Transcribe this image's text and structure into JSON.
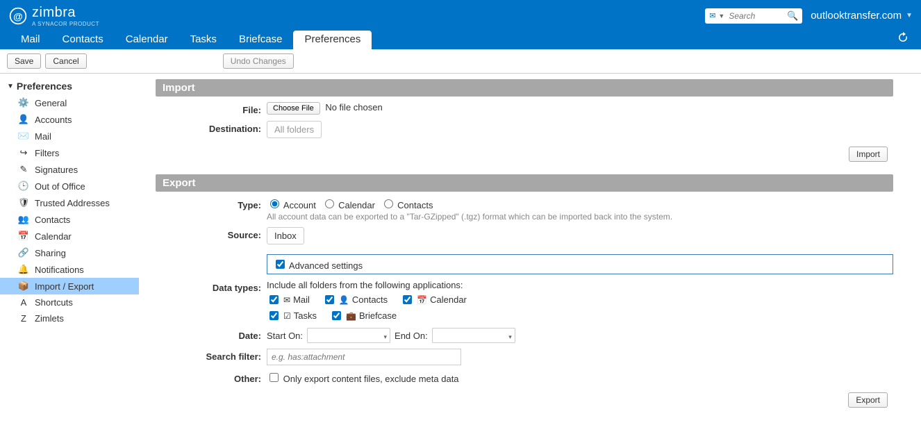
{
  "header": {
    "brand": "zimbra",
    "brand_sub": "A SYNACOR PRODUCT",
    "search_placeholder": "Search",
    "account": "outlooktransfer.com"
  },
  "nav": {
    "items": [
      "Mail",
      "Contacts",
      "Calendar",
      "Tasks",
      "Briefcase",
      "Preferences"
    ],
    "active": "Preferences"
  },
  "toolbar": {
    "save": "Save",
    "cancel": "Cancel",
    "undo": "Undo Changes"
  },
  "sidebar": {
    "title": "Preferences",
    "items": [
      {
        "label": "General",
        "icon": "⚙️"
      },
      {
        "label": "Accounts",
        "icon": "👤"
      },
      {
        "label": "Mail",
        "icon": "✉️"
      },
      {
        "label": "Filters",
        "icon": "↪"
      },
      {
        "label": "Signatures",
        "icon": "✎"
      },
      {
        "label": "Out of Office",
        "icon": "🕒"
      },
      {
        "label": "Trusted Addresses",
        "icon": "🛡"
      },
      {
        "label": "Contacts",
        "icon": "👥"
      },
      {
        "label": "Calendar",
        "icon": "📅"
      },
      {
        "label": "Sharing",
        "icon": "🔗"
      },
      {
        "label": "Notifications",
        "icon": "🔔"
      },
      {
        "label": "Import / Export",
        "icon": "📦",
        "selected": true
      },
      {
        "label": "Shortcuts",
        "icon": "A"
      },
      {
        "label": "Zimlets",
        "icon": "Z"
      }
    ]
  },
  "import": {
    "section": "Import",
    "file_label": "File:",
    "choose_file": "Choose File",
    "no_file": "No file chosen",
    "dest_label": "Destination:",
    "dest_value": "All folders",
    "button": "Import"
  },
  "export": {
    "section": "Export",
    "type_label": "Type:",
    "type_options": [
      "Account",
      "Calendar",
      "Contacts"
    ],
    "type_selected": "Account",
    "type_hint": "All account data can be exported to a \"Tar-GZipped\" (.tgz) format which can be imported back into the system.",
    "source_label": "Source:",
    "source_value": "Inbox",
    "advanced_label": "Advanced settings",
    "advanced_checked": true,
    "datatypes_label": "Data types:",
    "datatypes_hint": "Include all folders from the following applications:",
    "datatypes": [
      {
        "label": "Mail",
        "icon": "✉",
        "checked": true
      },
      {
        "label": "Contacts",
        "icon": "👤",
        "checked": true
      },
      {
        "label": "Calendar",
        "icon": "📅",
        "checked": true
      },
      {
        "label": "Tasks",
        "icon": "☑",
        "checked": true
      },
      {
        "label": "Briefcase",
        "icon": "💼",
        "checked": true
      }
    ],
    "date_label": "Date:",
    "date_start": "Start On:",
    "date_end": "End On:",
    "filter_label": "Search filter:",
    "filter_placeholder": "e.g. has:attachment",
    "other_label": "Other:",
    "other_option": "Only export content files, exclude meta data",
    "button": "Export"
  }
}
